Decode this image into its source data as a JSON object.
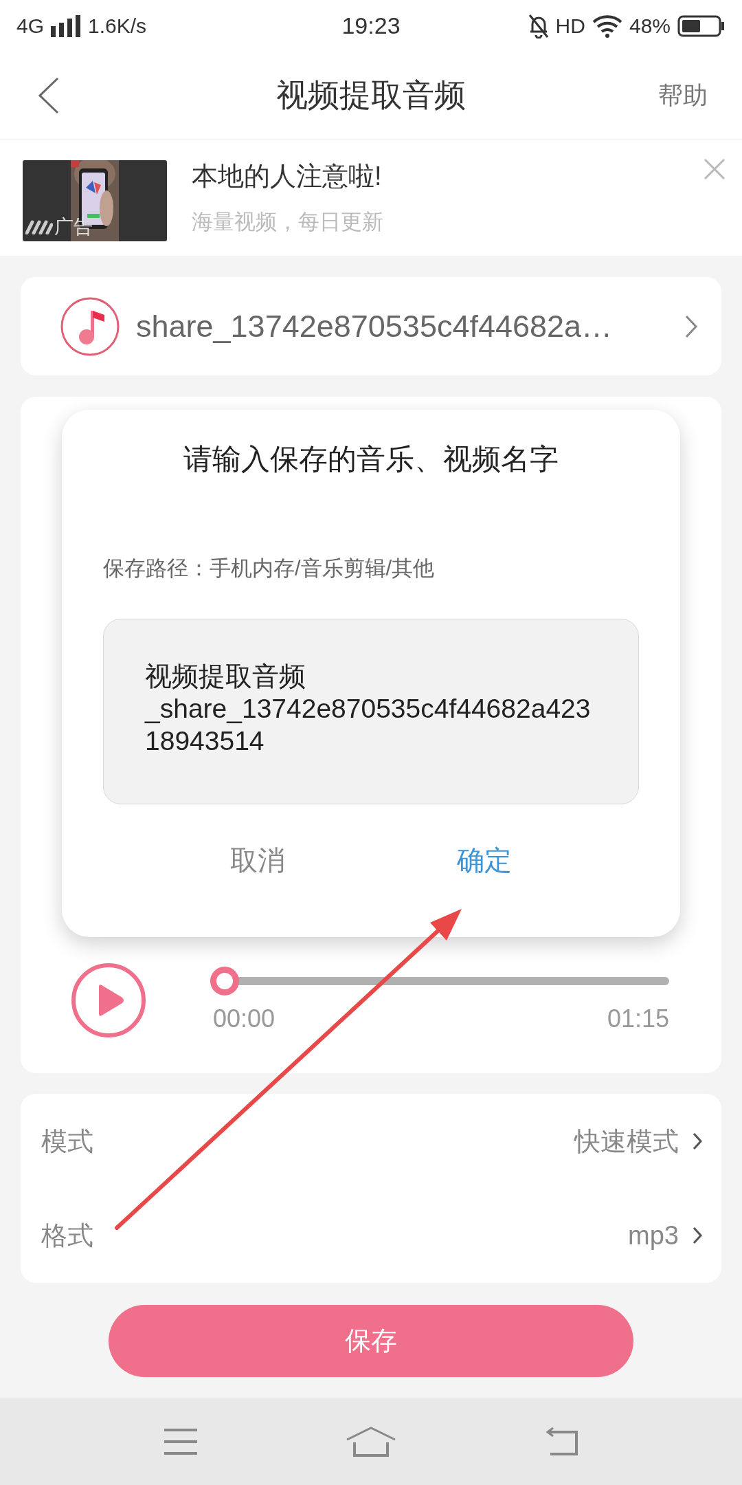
{
  "status_bar": {
    "network": "4G",
    "speed": "1.6K/s",
    "time": "19:23",
    "hd": "HD",
    "battery": "48%"
  },
  "header": {
    "title": "视频提取音频",
    "help": "帮助"
  },
  "ad": {
    "title": "本地的人注意啦!",
    "subtitle": "海量视频，每日更新",
    "badge": "广告"
  },
  "file": {
    "name": "share_13742e870535c4f44682a…"
  },
  "player": {
    "level": 0,
    "current": "00:00",
    "duration": "01:15"
  },
  "settings": [
    {
      "label": "模式",
      "value": "快速模式"
    },
    {
      "label": "格式",
      "value": "mp3"
    }
  ],
  "save_button": "保存",
  "dialog": {
    "title": "请输入保存的音乐、视频名字",
    "path": "保存路径：手机内存/音乐剪辑/其他",
    "value": "视频提取音频_share_13742e870535c4f44682a42318943514",
    "buttons": [
      {
        "label": "取消",
        "kind": "cancel"
      },
      {
        "label": "确定",
        "kind": "confirm"
      }
    ]
  }
}
